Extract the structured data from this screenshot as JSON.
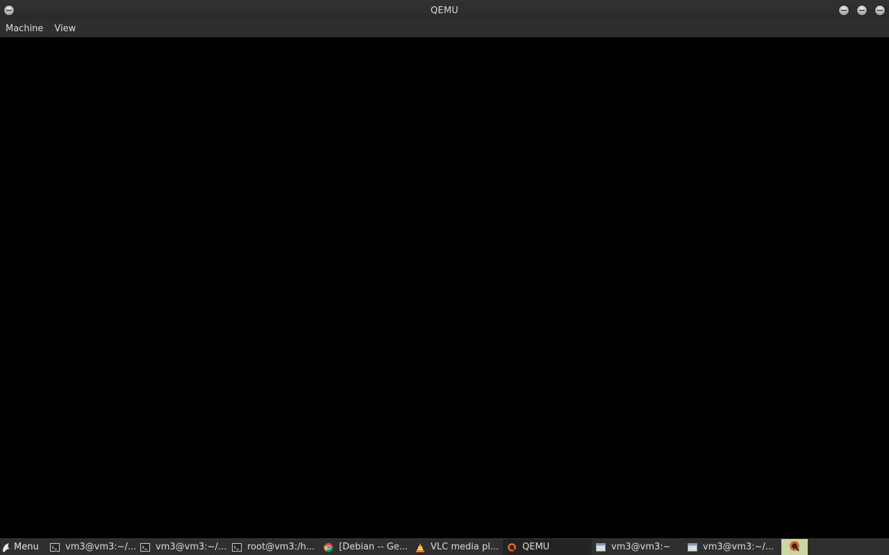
{
  "window": {
    "title": "QEMU",
    "menu": [
      "Machine",
      "View"
    ]
  },
  "taskbar": {
    "start_label": "Menu",
    "items": [
      {
        "label": "vm3@vm3:~/...",
        "icon": "terminal-icon"
      },
      {
        "label": "vm3@vm3:~/...",
        "icon": "terminal-icon"
      },
      {
        "label": "root@vm3:/h...",
        "icon": "terminal-icon"
      },
      {
        "label": "[Debian -- Ge...",
        "icon": "chrome-icon"
      },
      {
        "label": "VLC media pl...",
        "icon": "vlc-icon"
      },
      {
        "label": "QEMU",
        "icon": "qemu-icon",
        "active": true
      },
      {
        "label": "vm3@vm3:~",
        "icon": "window-icon"
      },
      {
        "label": "vm3@vm3:~/...",
        "icon": "window-icon"
      }
    ],
    "tray_icon": "qemu-icon"
  }
}
